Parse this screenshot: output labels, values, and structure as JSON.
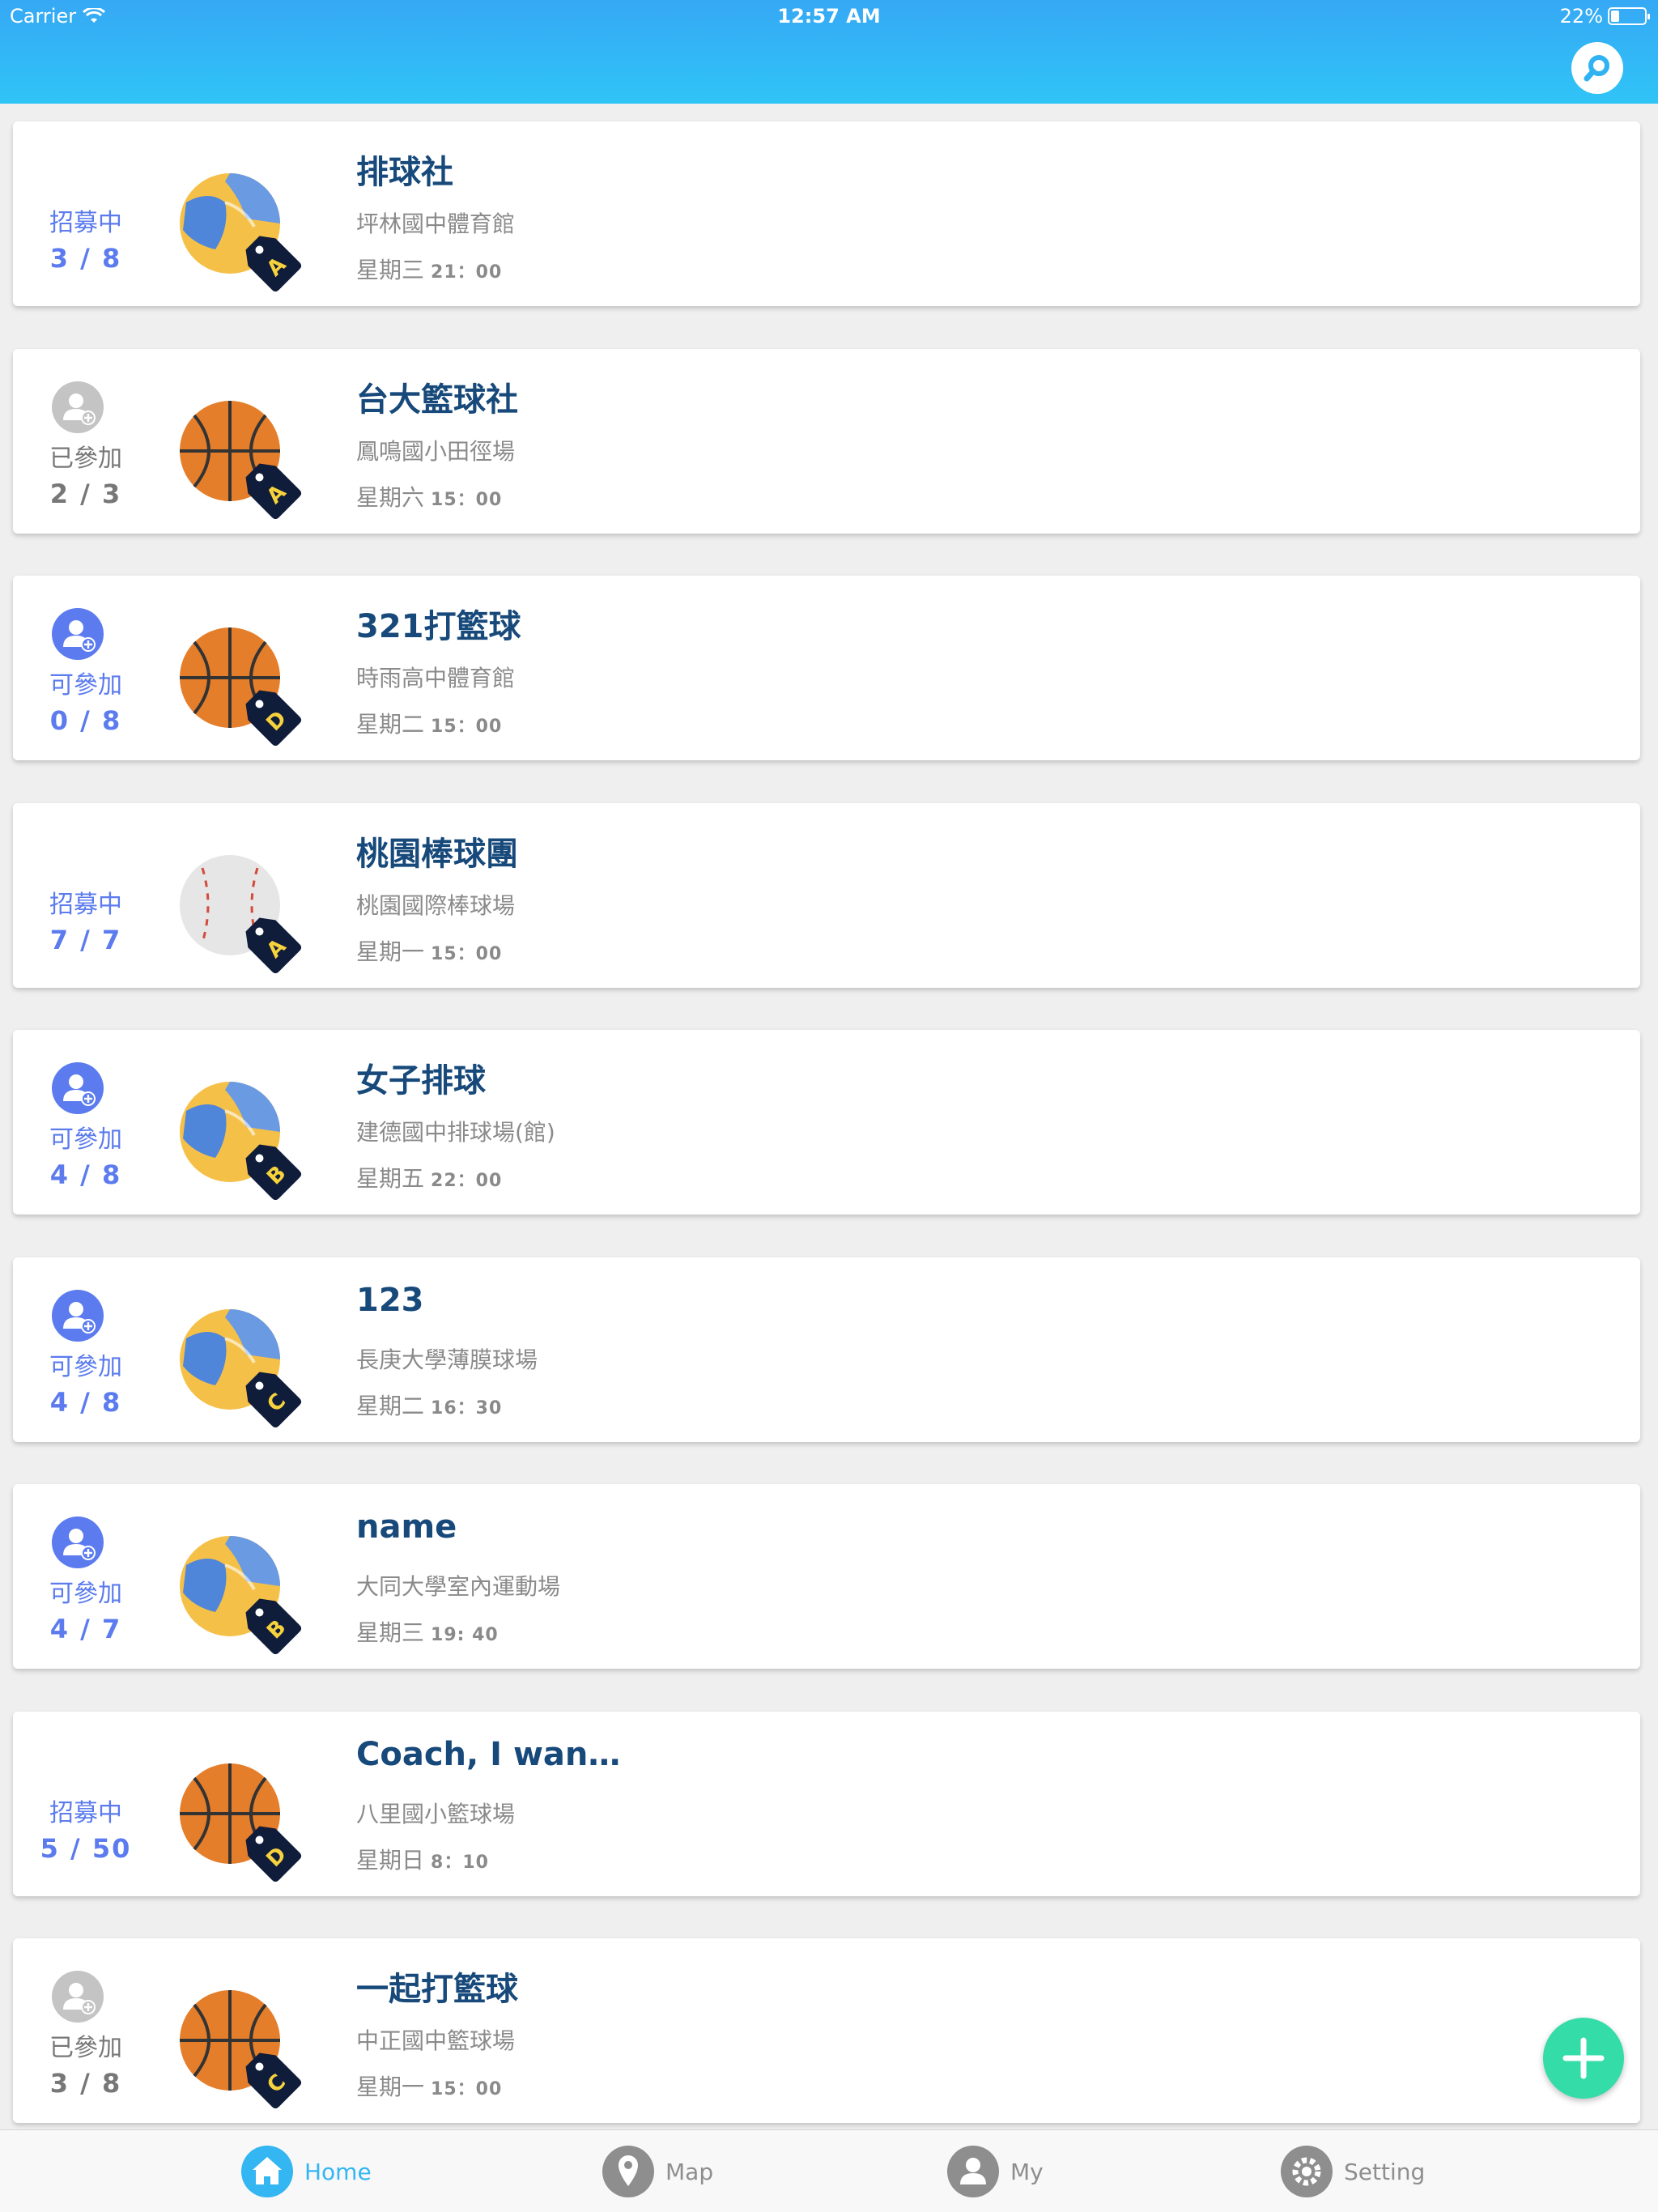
{
  "status_bar": {
    "carrier": "Carrier",
    "time": "12:57 AM",
    "battery": "22%"
  },
  "header": {
    "search_icon": "search-icon"
  },
  "colors": {
    "header_top": "#36a8f5",
    "header_bottom": "#2fc4f6",
    "title": "#17497a",
    "recruiting": "#5b7bee",
    "joined": "#777777",
    "can_join": "#5b7bee",
    "fab": "#34dca8",
    "active_tab": "#33b6f2"
  },
  "groups": [
    {
      "status": "招募中",
      "status_type": "recruiting",
      "count": "3 / 8",
      "ball": "volleyball",
      "level": "A",
      "title": "排球社",
      "venue": "坪林國中體育館",
      "day": "星期三",
      "hm": "21：00"
    },
    {
      "status": "已參加",
      "status_type": "joined",
      "count": "2 / 3",
      "ball": "basketball",
      "level": "A",
      "title": "台大籃球社",
      "venue": "鳳鳴國小田徑場",
      "day": "星期六",
      "hm": "15：00"
    },
    {
      "status": "可參加",
      "status_type": "can_join",
      "count": "0 / 8",
      "ball": "basketball",
      "level": "D",
      "title": "321打籃球",
      "venue": "時雨高中體育館",
      "day": "星期二",
      "hm": "15：00"
    },
    {
      "status": "招募中",
      "status_type": "recruiting",
      "count": "7 / 7",
      "ball": "baseball",
      "level": "A",
      "title": "桃園棒球團",
      "venue": "桃園國際棒球場",
      "day": "星期一",
      "hm": "15：00"
    },
    {
      "status": "可參加",
      "status_type": "can_join",
      "count": "4 / 8",
      "ball": "volleyball",
      "level": "B",
      "title": "女子排球",
      "venue": "建德國中排球場(館)",
      "day": "星期五",
      "hm": "22：00"
    },
    {
      "status": "可參加",
      "status_type": "can_join",
      "count": "4 / 8",
      "ball": "volleyball",
      "level": "C",
      "title": "123",
      "venue": "長庚大學薄膜球場",
      "day": "星期二",
      "hm": "16：30"
    },
    {
      "status": "可參加",
      "status_type": "can_join",
      "count": "4 / 7",
      "ball": "volleyball",
      "level": "B",
      "title": "name",
      "venue": "大同大學室內運動場",
      "day": "星期三",
      "hm": "19: 40"
    },
    {
      "status": "招募中",
      "status_type": "recruiting",
      "count": "5 / 50",
      "ball": "basketball",
      "level": "D",
      "title": "Coach, I wan…",
      "venue": "八里國小籃球場",
      "day": "星期日",
      "hm": "8：10"
    },
    {
      "status": "已參加",
      "status_type": "joined",
      "count": "3 / 8",
      "ball": "basketball",
      "level": "C",
      "title": "一起打籃球",
      "venue": "中正國中籃球場",
      "day": "星期一",
      "hm": "15：00"
    }
  ],
  "fab": {
    "icon": "plus-icon"
  },
  "tabs": [
    {
      "label": "Home",
      "icon": "home-icon",
      "active": true
    },
    {
      "label": "Map",
      "icon": "map-pin-icon",
      "active": false
    },
    {
      "label": "My",
      "icon": "user-icon",
      "active": false
    },
    {
      "label": "Setting",
      "icon": "gear-icon",
      "active": false
    }
  ]
}
